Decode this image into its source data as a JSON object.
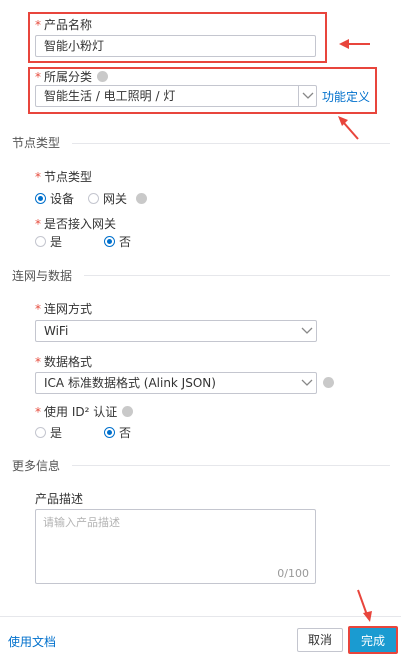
{
  "product_name": {
    "label": "产品名称",
    "value": "智能小粉灯"
  },
  "category": {
    "label": "所属分类",
    "value": "智能生活 / 电工照明 / 灯",
    "link": "功能定义"
  },
  "node_section": "节点类型",
  "node_type": {
    "label": "节点类型",
    "options": [
      "设备",
      "网关"
    ],
    "selected": "设备"
  },
  "gateway_access": {
    "label": "是否接入网关",
    "options": [
      "是",
      "否"
    ],
    "selected": "否"
  },
  "network_section": "连网与数据",
  "network_method": {
    "label": "连网方式",
    "value": "WiFi"
  },
  "data_format": {
    "label": "数据格式",
    "value": "ICA 标准数据格式 (Alink JSON)"
  },
  "id2_auth": {
    "label": "使用 ID² 认证",
    "options": [
      "是",
      "否"
    ],
    "selected": "否"
  },
  "more_section": "更多信息",
  "description": {
    "label": "产品描述",
    "placeholder": "请输入产品描述",
    "count": "0/100"
  },
  "footer": {
    "doc_link": "使用文档",
    "cancel": "取消",
    "done": "完成"
  },
  "colors": {
    "accent": "#0070cc",
    "required": "#e64b3c",
    "annotation": "#e8453c",
    "primary_button": "#1a9bd1"
  }
}
